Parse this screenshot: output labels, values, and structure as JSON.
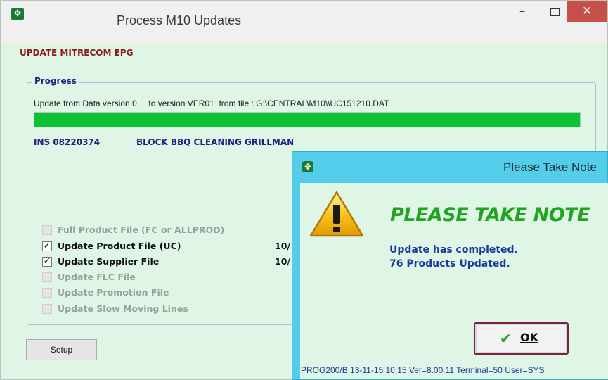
{
  "main_window": {
    "title": "Process M10 Updates",
    "app_icon": "move-cross-icon",
    "controls": {
      "minimize": "–",
      "maximize": "maximize-icon",
      "close": "✕"
    },
    "heading": "UPDATE MITRECOM EPG",
    "progress": {
      "group_label": "Progress",
      "update_text": "Update from Data version 0     to version VER01  from file : G:\\CENTRAL\\M10\\\\UC151210.DAT",
      "bar_fraction": 1.0,
      "bar_color": "#0cc234",
      "item_code": "INS 08220374",
      "item_desc": "BLOCK BBQ CLEANING GRILLMAN"
    },
    "options": [
      {
        "label": "Full Product File (FC or ALLPROD)",
        "checked": false,
        "enabled": false,
        "date": ""
      },
      {
        "label": "Update Product File (UC)",
        "checked": true,
        "enabled": true,
        "date": "10/"
      },
      {
        "label": "Update Supplier File",
        "checked": true,
        "enabled": true,
        "date": "10/"
      },
      {
        "label": "Update FLC File",
        "checked": false,
        "enabled": false,
        "date": ""
      },
      {
        "label": "Update Promotion File",
        "checked": false,
        "enabled": false,
        "date": ""
      },
      {
        "label": "Update Slow Moving Lines",
        "checked": false,
        "enabled": false,
        "date": ""
      }
    ],
    "setup_label": "Setup"
  },
  "dialog": {
    "title": "Please Take Note",
    "icon": "warning-icon",
    "heading": "PLEASE TAKE NOTE",
    "line1": "Update has completed.",
    "line2": "76 Products Updated.",
    "ok_label": "OK",
    "status": "PROG200/B  13-11-15 10:15  Ver=8.00.11 Terminal=50 User=SYS"
  },
  "colors": {
    "window_bg": "#dff5e6",
    "dialog_frame": "#54cdea",
    "heading_red": "#8b1a1a",
    "navy": "#1a237e",
    "note_green": "#1fa51f",
    "close_red": "#c7504b"
  }
}
